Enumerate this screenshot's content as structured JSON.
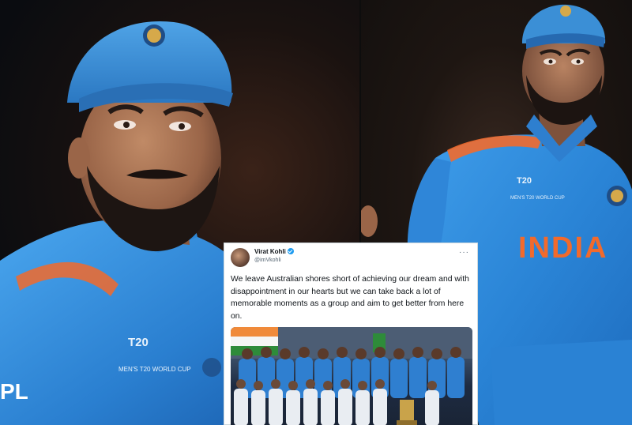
{
  "left_photo": {
    "jersey_text": "PL",
    "badge_text": "MEN'S T20 WORLD CUP"
  },
  "right_photo": {
    "jersey_text": "INDIA",
    "badge_text": "MEN'S T20 WORLD CUP"
  },
  "tweet": {
    "author_name": "Virat Kohli",
    "author_handle": "@imVkohli",
    "more_label": "···",
    "text": "We leave Australian shores short of achieving our dream and with disappointment in our hearts but we can take back a lot of memorable moments as a group and aim to get better from here on."
  },
  "colors": {
    "jersey_blue": "#2f8fe0",
    "cap_blue": "#3b8fd6",
    "jersey_orange": "#f26a2c",
    "verified_blue": "#1d9bf0"
  }
}
